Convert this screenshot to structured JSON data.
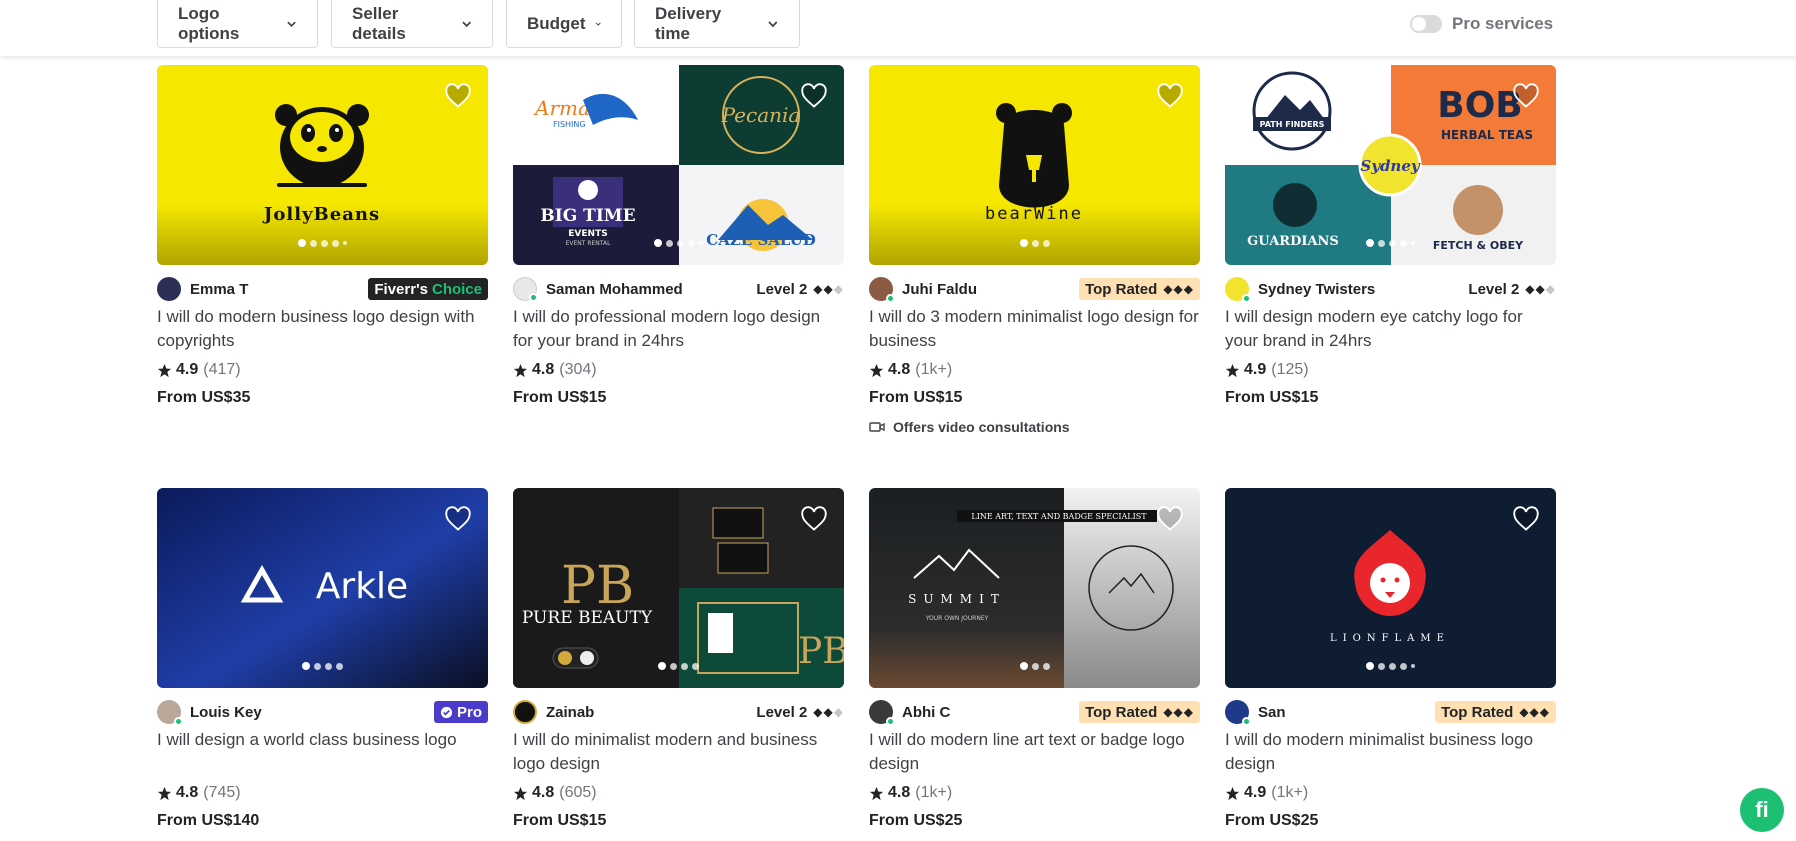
{
  "filters": [
    {
      "label": "Logo options"
    },
    {
      "label": "Seller details"
    },
    {
      "label": "Budget"
    },
    {
      "label": "Delivery time"
    }
  ],
  "pro_services_label": "Pro services",
  "brand_colors": {
    "green": "#1dbf73",
    "pro_purple": "#4a3bcb",
    "top_rated_bg": "#ffe0b3"
  },
  "gigs": [
    {
      "seller": "Emma T",
      "badge_type": "choice",
      "badge_text": "Fiverr's",
      "badge_text2": "Choice",
      "title": "I will do modern business logo design with copyrights",
      "rating": "4.9",
      "reviews": "(417)",
      "price": "From US$35",
      "image_text": "JollyBeans",
      "dots": 5
    },
    {
      "seller": "Saman Mohammed",
      "badge_type": "level",
      "badge_text": "Level 2",
      "title": "I will do professional modern logo design for your brand in 24hrs",
      "rating": "4.8",
      "reviews": "(304)",
      "price": "From US$15",
      "image_text": [
        "Armani",
        "FISHING",
        "Pecania",
        "BIG TIME",
        "EVENTS",
        "EVENT RENTAL",
        "CAZE SALUD"
      ],
      "dots": 5
    },
    {
      "seller": "Juhi Faldu",
      "badge_type": "toprated",
      "badge_text": "Top Rated",
      "title": "I will do 3 modern minimalist logo design for business",
      "rating": "4.8",
      "reviews": "(1k+)",
      "price": "From US$15",
      "extra": "Offers video consultations",
      "image_text": "bearWine",
      "dots": 3
    },
    {
      "seller": "Sydney Twisters",
      "badge_type": "level",
      "badge_text": "Level 2",
      "title": "I will design modern eye catchy logo for your brand in 24hrs",
      "rating": "4.9",
      "reviews": "(125)",
      "price": "From US$15",
      "image_text": [
        "PATH FINDERS",
        "BOB",
        "HERBAL TEAS",
        "Sydney",
        "GUARDIANS",
        "FETCH & OBEY"
      ],
      "dots": 5
    },
    {
      "seller": "Louis Key",
      "badge_type": "pro",
      "badge_text": "Pro",
      "title": "I will design a world class business logo",
      "rating": "4.8",
      "reviews": "(745)",
      "price": "From US$140",
      "image_text": "Arkle",
      "dots": 4
    },
    {
      "seller": "Zainab",
      "badge_type": "level",
      "badge_text": "Level 2",
      "title": "I will do minimalist modern and business logo design",
      "rating": "4.8",
      "reviews": "(605)",
      "price": "From US$15",
      "image_text": [
        "PURE BEAUTY",
        "PB"
      ],
      "dots": 4
    },
    {
      "seller": "Abhi C",
      "badge_type": "toprated",
      "badge_text": "Top Rated",
      "title": "I will do modern line art text or badge logo design",
      "rating": "4.8",
      "reviews": "(1k+)",
      "price": "From US$25",
      "image_text": [
        "LINE ART, TEXT AND BADGE SPECIALIST",
        "SUMMIT",
        "YOUR OWN JOURNEY"
      ],
      "dots": 3
    },
    {
      "seller": "San",
      "badge_type": "toprated",
      "badge_text": "Top Rated",
      "title": "I will do modern minimalist business logo design",
      "rating": "4.9",
      "reviews": "(1k+)",
      "price": "From US$25",
      "image_text": "LIONFLAME",
      "dots": 5
    }
  ],
  "fab_label": "fi"
}
